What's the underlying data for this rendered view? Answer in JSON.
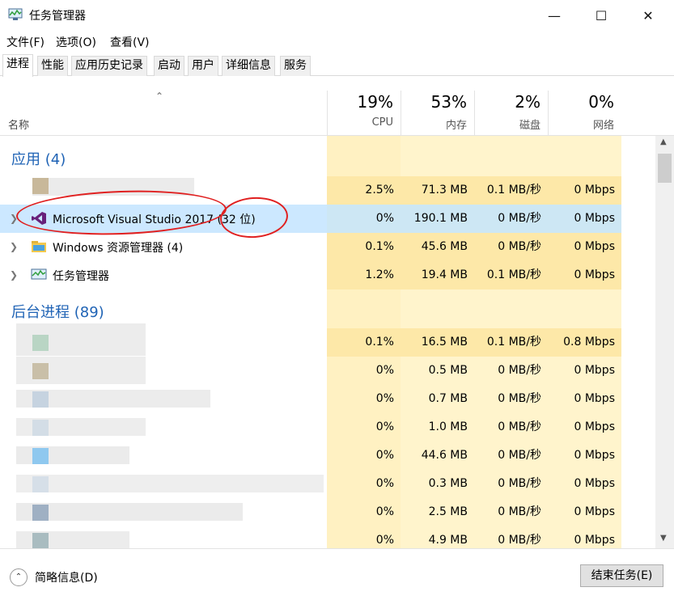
{
  "window": {
    "title": "任务管理器"
  },
  "menu": [
    "文件(F)",
    "选项(O)",
    "查看(V)"
  ],
  "tabs": [
    "进程",
    "性能",
    "应用历史记录",
    "启动",
    "用户",
    "详细信息",
    "服务"
  ],
  "columns": {
    "name": "名称",
    "cpu": {
      "pct": "19%",
      "label": "CPU"
    },
    "mem": {
      "pct": "53%",
      "label": "内存"
    },
    "disk": {
      "pct": "2%",
      "label": "磁盘"
    },
    "net": {
      "pct": "0%",
      "label": "网络"
    }
  },
  "groups": {
    "apps": "应用 (4)",
    "background": "后台进程 (89)"
  },
  "apps": [
    {
      "name": "",
      "cpu": "2.5%",
      "mem": "71.3 MB",
      "disk": "0.1 MB/秒",
      "net": "0 Mbps"
    },
    {
      "name": "Microsoft Visual Studio 2017 (32 位)",
      "cpu": "0%",
      "mem": "190.1 MB",
      "disk": "0 MB/秒",
      "net": "0 Mbps"
    },
    {
      "name": "Windows 资源管理器 (4)",
      "cpu": "0.1%",
      "mem": "45.6 MB",
      "disk": "0 MB/秒",
      "net": "0 Mbps"
    },
    {
      "name": "任务管理器",
      "cpu": "1.2%",
      "mem": "19.4 MB",
      "disk": "0.1 MB/秒",
      "net": "0 Mbps"
    }
  ],
  "background": [
    {
      "cpu": "0.1%",
      "mem": "16.5 MB",
      "disk": "0.1 MB/秒",
      "net": "0.8 Mbps"
    },
    {
      "cpu": "0%",
      "mem": "0.5 MB",
      "disk": "0 MB/秒",
      "net": "0 Mbps"
    },
    {
      "cpu": "0%",
      "mem": "0.7 MB",
      "disk": "0 MB/秒",
      "net": "0 Mbps"
    },
    {
      "cpu": "0%",
      "mem": "1.0 MB",
      "disk": "0 MB/秒",
      "net": "0 Mbps"
    },
    {
      "cpu": "0%",
      "mem": "44.6 MB",
      "disk": "0 MB/秒",
      "net": "0 Mbps"
    },
    {
      "cpu": "0%",
      "mem": "0.3 MB",
      "disk": "0 MB/秒",
      "net": "0 Mbps"
    },
    {
      "cpu": "0%",
      "mem": "2.5 MB",
      "disk": "0 MB/秒",
      "net": "0 Mbps"
    },
    {
      "cpu": "0%",
      "mem": "4.9 MB",
      "disk": "0 MB/秒",
      "net": "0 Mbps"
    }
  ],
  "footer": {
    "fewer_details": "简略信息(D)",
    "end_task": "结束任务(E)"
  }
}
